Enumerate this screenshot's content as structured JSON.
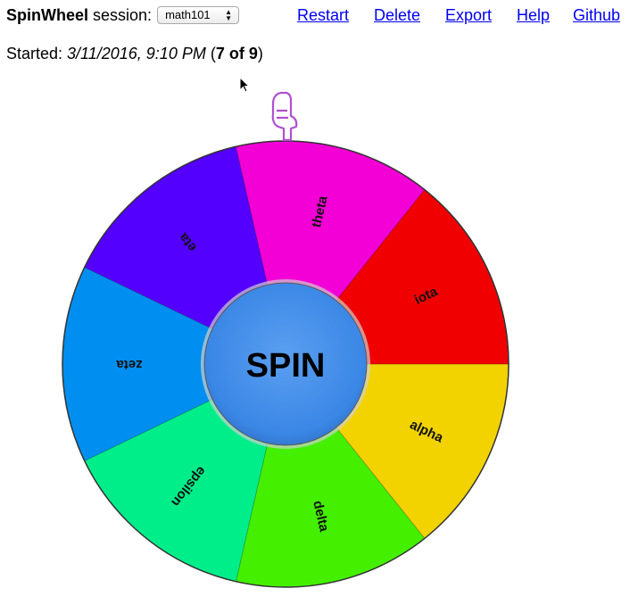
{
  "header": {
    "app_name": "SpinWheel",
    "session_label": "session:",
    "session_select": {
      "selected": "math101"
    },
    "links": {
      "restart": "Restart",
      "delete": "Delete",
      "export": "Export",
      "help": "Help",
      "github": "Github"
    }
  },
  "status": {
    "started_prefix": "Started: ",
    "started_time": "3/11/2016, 9:10 PM",
    "count_open": " (",
    "count": "7 of 9",
    "count_close": ")"
  },
  "wheel": {
    "spin_label": "SPIN",
    "border_color": "#333333",
    "hub_color": "#3b87e6",
    "pointer_color": "#b04fd0",
    "segments": [
      {
        "label": "alpha",
        "color": "#f2d300"
      },
      {
        "label": "delta",
        "color": "#44f000"
      },
      {
        "label": "epsilon",
        "color": "#00ee8a"
      },
      {
        "label": "zeta",
        "color": "#008ff0"
      },
      {
        "label": "eta",
        "color": "#5300ff"
      },
      {
        "label": "theta",
        "color": "#f200d6"
      },
      {
        "label": "iota",
        "color": "#f00000"
      }
    ]
  },
  "icons": {
    "pointer": "pointing-hand-icon",
    "mouse": "mouse-cursor-icon"
  }
}
